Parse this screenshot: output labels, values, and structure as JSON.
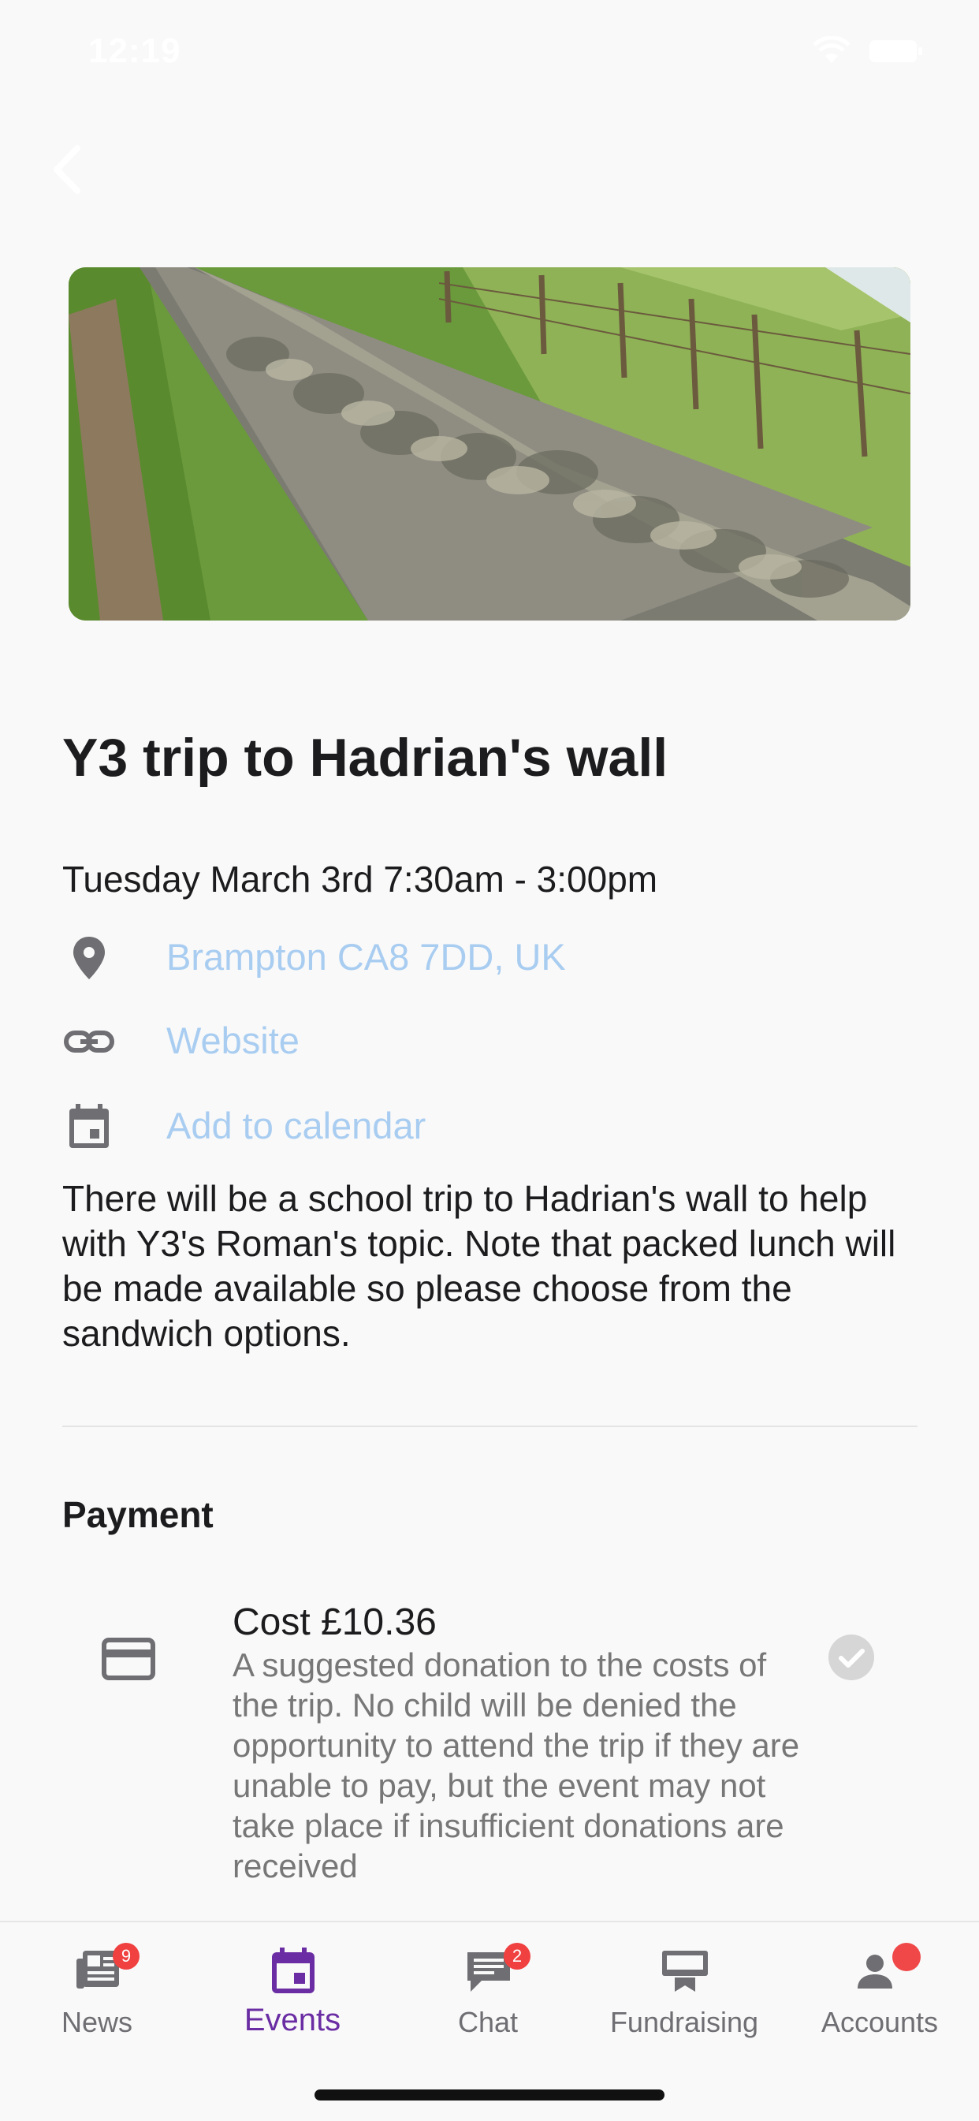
{
  "status_bar": {
    "time": "12:19"
  },
  "event": {
    "title": "Y3 trip to Hadrian's wall",
    "datetime": "Tuesday March 3rd 7:30am - 3:00pm",
    "location": "Brampton CA8 7DD, UK",
    "website_label": "Website",
    "calendar_label": "Add to calendar",
    "description": "There will be a school trip to Hadrian's wall to help with Y3's Roman's topic. Note that packed lunch will be made available so please choose from the sandwich options."
  },
  "payment": {
    "section_title": "Payment",
    "cost_label": "Cost £10.36",
    "description": "A suggested donation to the costs of the trip. No child will be denied the opportunity to attend the trip if they are unable to pay, but the event may not take place if insufficient donations are received"
  },
  "tabs": [
    {
      "label": "News",
      "icon": "newspaper-icon",
      "badge": "9"
    },
    {
      "label": "Events",
      "icon": "calendar-icon",
      "active": true
    },
    {
      "label": "Chat",
      "icon": "chat-icon",
      "badge": "2"
    },
    {
      "label": "Fundraising",
      "icon": "fundraising-icon"
    },
    {
      "label": "Accounts",
      "icon": "person-icon",
      "dot": true
    }
  ],
  "colors": {
    "accent": "#6a2da3",
    "link": "#a9cdf1",
    "badge": "#f04040",
    "icon_gray": "#6e6e73"
  }
}
